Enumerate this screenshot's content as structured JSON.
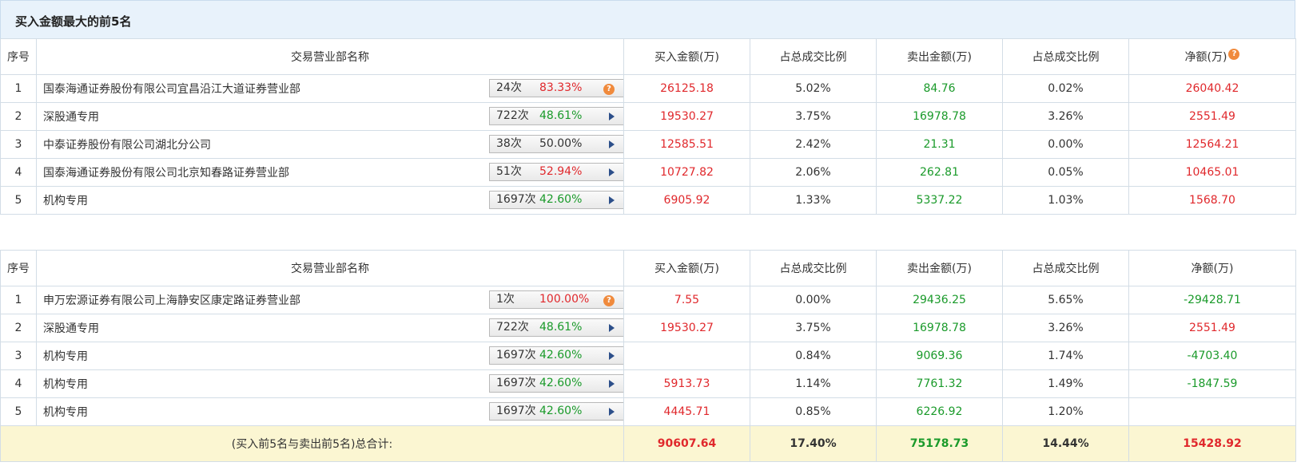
{
  "title": "买入金额最大的前5名",
  "columns": [
    "序号",
    "交易营业部名称",
    "买入金额(万)",
    "占总成交比例",
    "卖出金额(万)",
    "占总成交比例",
    "净额(万)"
  ],
  "buy_rows": [
    {
      "idx": "1",
      "name": "国泰海通证券股份有限公司宜昌沿江大道证券营业部",
      "count": "24次",
      "pct": "83.33%",
      "pct_color": "red",
      "icon": "help-icon",
      "buy": "26125.18",
      "buy_ratio": "5.02%",
      "sell": "84.76",
      "sell_ratio": "0.02%",
      "net": "26040.42",
      "net_color": "red"
    },
    {
      "idx": "2",
      "name": "深股通专用",
      "count": "722次",
      "pct": "48.61%",
      "pct_color": "green",
      "icon": "play-arrow-icon",
      "buy": "19530.27",
      "buy_ratio": "3.75%",
      "sell": "16978.78",
      "sell_ratio": "3.26%",
      "net": "2551.49",
      "net_color": "red"
    },
    {
      "idx": "3",
      "name": "中泰证券股份有限公司湖北分公司",
      "count": "38次",
      "pct": "50.00%",
      "pct_color": "black",
      "icon": "play-arrow-icon",
      "buy": "12585.51",
      "buy_ratio": "2.42%",
      "sell": "21.31",
      "sell_ratio": "0.00%",
      "net": "12564.21",
      "net_color": "red"
    },
    {
      "idx": "4",
      "name": "国泰海通证券股份有限公司北京知春路证券营业部",
      "count": "51次",
      "pct": "52.94%",
      "pct_color": "red",
      "icon": "play-arrow-icon",
      "buy": "10727.82",
      "buy_ratio": "2.06%",
      "sell": "262.81",
      "sell_ratio": "0.05%",
      "net": "10465.01",
      "net_color": "red"
    },
    {
      "idx": "5",
      "name": "机构专用",
      "count": "1697次",
      "pct": "42.60%",
      "pct_color": "green",
      "icon": "play-arrow-icon",
      "buy": "6905.92",
      "buy_ratio": "1.33%",
      "sell": "5337.22",
      "sell_ratio": "1.03%",
      "net": "1568.70",
      "net_color": "red"
    }
  ],
  "sell_rows": [
    {
      "idx": "1",
      "name": "申万宏源证券有限公司上海静安区康定路证券营业部",
      "count": "1次",
      "pct": "100.00%",
      "pct_color": "red",
      "icon": "help-icon",
      "buy": "7.55",
      "buy_ratio": "0.00%",
      "sell": "29436.25",
      "sell_ratio": "5.65%",
      "net": "-29428.71",
      "net_color": "green"
    },
    {
      "idx": "2",
      "name": "深股通专用",
      "count": "722次",
      "pct": "48.61%",
      "pct_color": "green",
      "icon": "play-arrow-icon",
      "buy": "19530.27",
      "buy_ratio": "3.75%",
      "sell": "16978.78",
      "sell_ratio": "3.26%",
      "net": "2551.49",
      "net_color": "red"
    },
    {
      "idx": "3",
      "name": "机构专用",
      "count": "1697次",
      "pct": "42.60%",
      "pct_color": "green",
      "icon": "play-arrow-icon",
      "buy": "",
      "buy_ratio": "0.84%",
      "sell": "9069.36",
      "sell_ratio": "1.74%",
      "net": "-4703.40",
      "net_color": "green"
    },
    {
      "idx": "4",
      "name": "机构专用",
      "count": "1697次",
      "pct": "42.60%",
      "pct_color": "green",
      "icon": "play-arrow-icon",
      "buy": "5913.73",
      "buy_ratio": "1.14%",
      "sell": "7761.32",
      "sell_ratio": "1.49%",
      "net": "-1847.59",
      "net_color": "green"
    },
    {
      "idx": "5",
      "name": "机构专用",
      "count": "1697次",
      "pct": "42.60%",
      "pct_color": "green",
      "icon": "play-arrow-icon",
      "buy": "4445.71",
      "buy_ratio": "0.85%",
      "sell": "6226.92",
      "sell_ratio": "1.20%",
      "net": "",
      "net_color": "green"
    }
  ],
  "total": {
    "label": "(买入前5名与卖出前5名)总合计:",
    "buy": "90607.64",
    "buy_ratio": "17.40%",
    "sell": "75178.73",
    "sell_ratio": "14.44%",
    "net": "15428.92"
  },
  "colors": {
    "red": "#e0282c",
    "green": "#1a9a2a",
    "header_bg": "#e8f2fb",
    "total_bg": "#fbf6d2",
    "icon_orange": "#f08a3c"
  }
}
